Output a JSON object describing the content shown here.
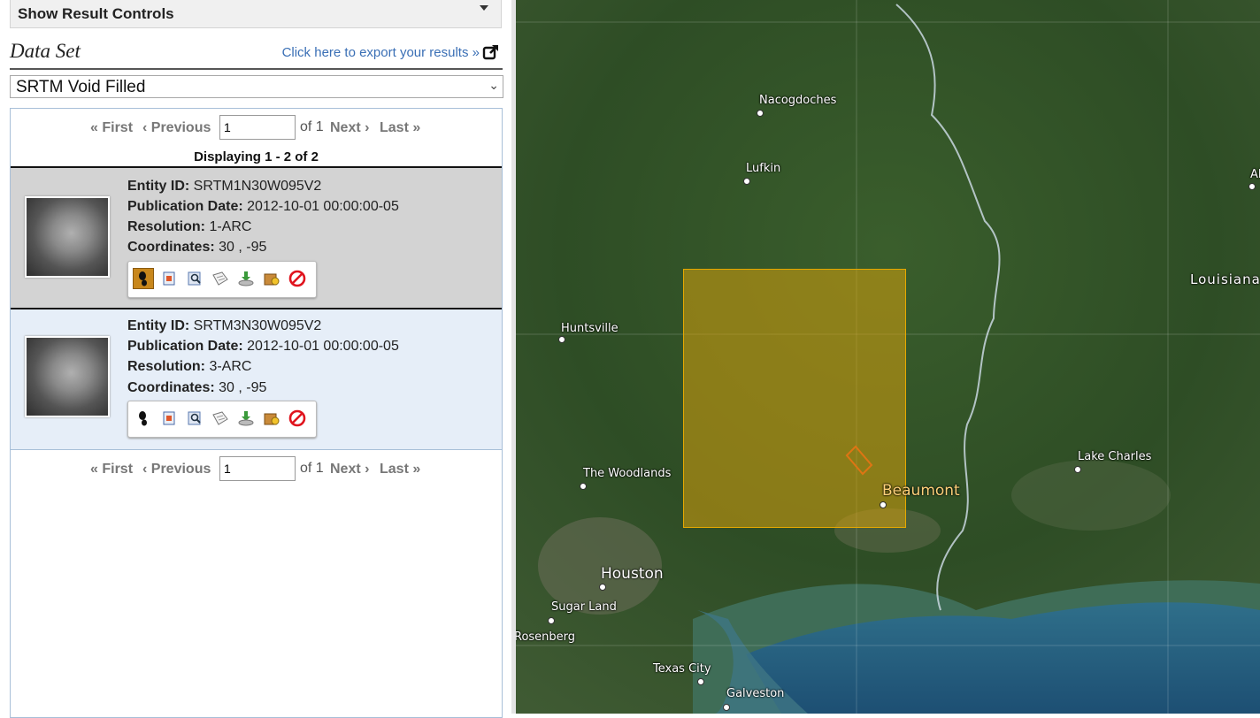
{
  "controls": {
    "show_result_controls": "Show Result Controls"
  },
  "dataset": {
    "title": "Data Set",
    "export_link": "Click here to export your results »",
    "selected": "SRTM Void Filled"
  },
  "pager": {
    "first": "« First",
    "previous": "‹ Previous",
    "page_value": "1",
    "of_text": "of 1",
    "next": "Next ›",
    "last": "Last »"
  },
  "displaying": "Displaying 1 - 2 of 2",
  "labels": {
    "entity_id": "Entity ID:",
    "publication_date": "Publication Date:",
    "resolution": "Resolution:",
    "coordinates": "Coordinates:"
  },
  "results": [
    {
      "entity_id": "SRTM1N30W095V2",
      "publication_date": "2012-10-01 00:00:00-05",
      "resolution": "1-ARC",
      "coordinates": "30 , -95",
      "selected": true
    },
    {
      "entity_id": "SRTM3N30W095V2",
      "publication_date": "2012-10-01 00:00:00-05",
      "resolution": "3-ARC",
      "coordinates": "30 , -95",
      "selected": false
    }
  ],
  "result_icons": [
    "footprint-icon",
    "overlay-icon",
    "browse-icon",
    "metadata-icon",
    "download-icon",
    "order-icon",
    "exclude-icon"
  ],
  "map": {
    "cities": {
      "nacogdoches": "Nacogdoches",
      "lufkin": "Lufkin",
      "huntsville": "Huntsville",
      "the_woodlands": "The Woodlands",
      "houston": "Houston",
      "sugar_land": "Sugar Land",
      "rosenberg": "Rosenberg",
      "texas_city": "Texas City",
      "galveston": "Galveston",
      "beaumont": "Beaumont",
      "lake_charles": "Lake Charles",
      "louisiana": "Louisiana",
      "edge_a": "Al"
    },
    "footprint_color": "#d6a00c"
  }
}
